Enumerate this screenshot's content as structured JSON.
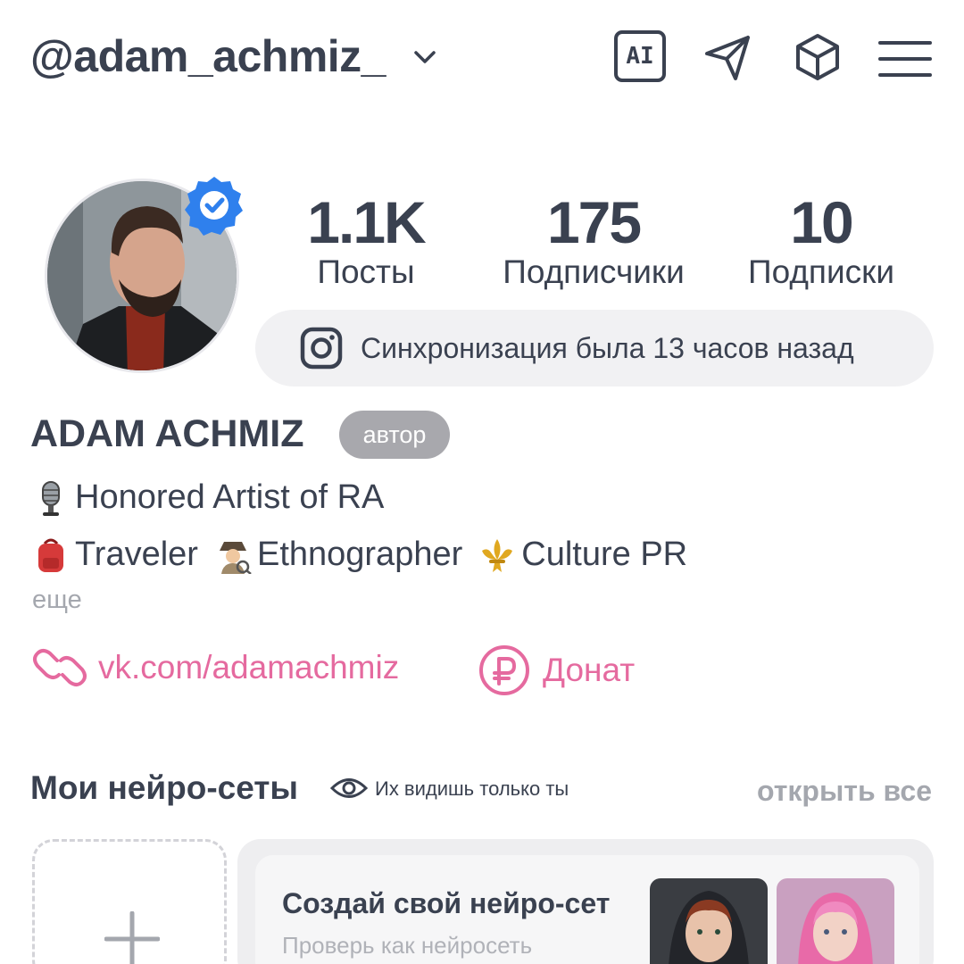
{
  "header": {
    "username": "@adam_achmiz_",
    "ai_label": "AI",
    "icons": [
      "chevron-down-icon",
      "ai-icon",
      "send-icon",
      "cube-icon",
      "menu-icon"
    ]
  },
  "profile": {
    "verified": true,
    "stats": [
      {
        "value": "1.1K",
        "label": "Посты"
      },
      {
        "value": "175",
        "label": "Подписчики"
      },
      {
        "value": "10",
        "label": "Подписки"
      }
    ],
    "sync_text": "Синхронизация была 13 часов назад",
    "display_name": "ADAM ACHMIZ",
    "role_badge": "автор",
    "bio_line1": "Honored Artist of RA",
    "bio_line2": {
      "part1": "Traveler",
      "part2": "Ethnographer",
      "part3": "Culture PR"
    },
    "more_label": "еще",
    "link_label": "vk.com/adamachmiz",
    "donate_label": "Донат"
  },
  "neuro_section": {
    "title": "Мои нейро-сеты",
    "visibility_note": "Их видишь только ты",
    "open_all": "открыть все",
    "promo_title": "Создай свой нейро-сет",
    "promo_subtitle": "Проверь как нейросеть"
  },
  "colors": {
    "text": "#3a4150",
    "accent_pink": "#e56a9f",
    "verified_blue": "#2f80ed",
    "muted": "#a4a7ae"
  }
}
